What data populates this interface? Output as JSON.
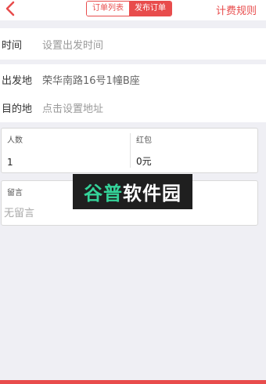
{
  "navbar": {
    "back_icon": "chevron-left-icon",
    "tabs": [
      {
        "label": "订单列表",
        "active": false
      },
      {
        "label": "发布订单",
        "active": true
      }
    ],
    "right_link": "计费规则",
    "accent_color": "#e84c4c"
  },
  "time_row": {
    "label": "时间",
    "value": "设置出发时间"
  },
  "origin_row": {
    "label": "出发地",
    "value": "荣华南路16号1幢B座"
  },
  "destination_row": {
    "label": "目的地",
    "value": "点击设置地址"
  },
  "order_info": {
    "people": {
      "label": "人数",
      "value": "1"
    },
    "red_packet": {
      "label": "红包",
      "value": "0元"
    }
  },
  "message": {
    "label": "留言",
    "placeholder": "无留言"
  },
  "watermark": {
    "accent_text": "谷普",
    "text": "软件园"
  }
}
